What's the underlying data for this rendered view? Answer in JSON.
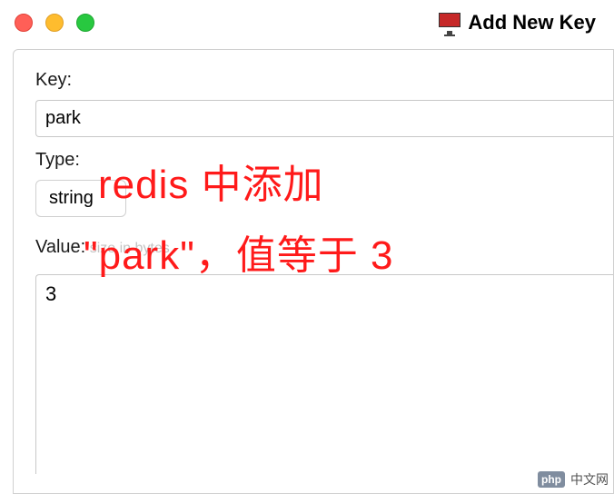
{
  "window": {
    "title": "Add New Key"
  },
  "form": {
    "key_label": "Key:",
    "key_value": "park",
    "type_label": "Type:",
    "type_value": "string",
    "value_label": "Value:",
    "value_ghost": "size in bytes",
    "value_text": "3"
  },
  "annotation": {
    "line1": "redis 中添加",
    "line2": "\"park\"，值等于 3"
  },
  "watermark": {
    "badge": "php",
    "text": "中文网"
  }
}
